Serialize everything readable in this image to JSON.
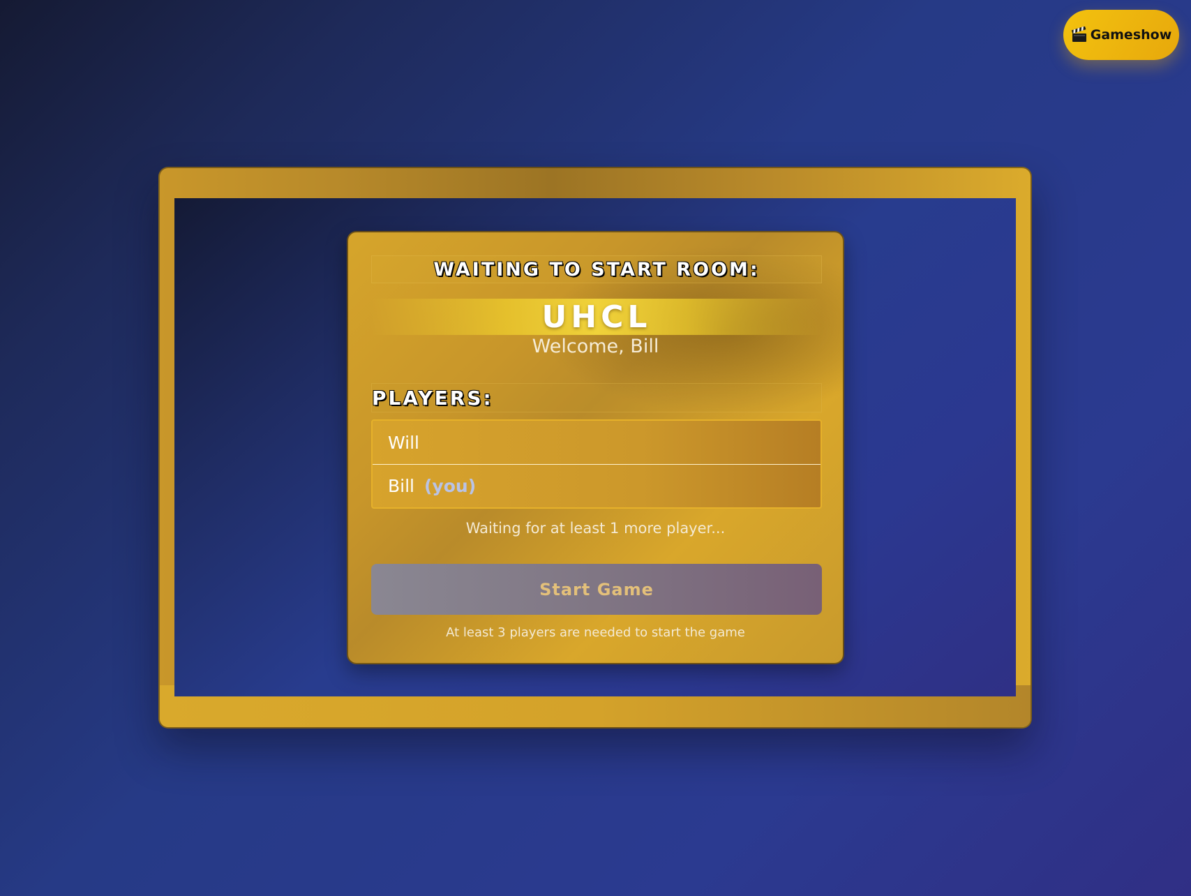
{
  "nav": {
    "brand_label": "Gameshow",
    "brand_icon": "clapper-board-icon"
  },
  "room": {
    "title": "WAITING TO START ROOM:",
    "code": "UHCL",
    "welcome": "Welcome, Bill"
  },
  "players": {
    "header": "PLAYERS:",
    "list": [
      {
        "name": "Will",
        "tag": ""
      },
      {
        "name": "Bill",
        "tag": "(you)"
      }
    ]
  },
  "status": {
    "waiting_message": "Waiting for at least 1 more player..."
  },
  "actions": {
    "start_label": "Start Game",
    "start_enabled": false,
    "hint": "At least 3 players are needed to start the game"
  },
  "colors": {
    "accent_gold": "#e7b72a",
    "background_navy": "#263a86",
    "disabled_button": "#807684",
    "you_tag": "#b9c3e6"
  }
}
